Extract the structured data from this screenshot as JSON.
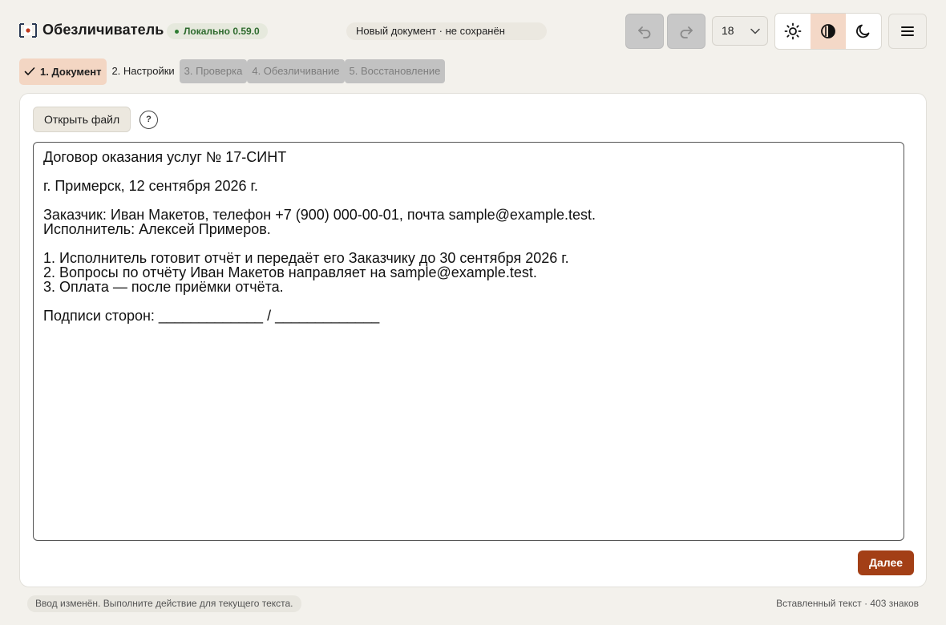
{
  "header": {
    "app_title": "Обезличиватель",
    "version_badge": "Локально 0.59.0",
    "doc_status": "Новый документ · не сохранён",
    "font_size_value": "18",
    "accent_color": "#a33f16",
    "icons": {
      "undo": "undo-icon",
      "redo": "redo-icon",
      "light_theme": "sun-icon",
      "contrast_theme": "contrast-icon",
      "dark_theme": "moon-icon",
      "menu": "hamburger-menu-icon"
    },
    "active_theme": "contrast"
  },
  "steps": [
    {
      "label": "1. Документ",
      "state": "active"
    },
    {
      "label": "2. Настройки",
      "state": "available"
    },
    {
      "label": "3. Проверка",
      "state": "disabled"
    },
    {
      "label": "4. Обезличивание",
      "state": "disabled"
    },
    {
      "label": "5. Восстановление",
      "state": "disabled"
    }
  ],
  "panel": {
    "open_file_label": "Открыть файл",
    "help_label": "?",
    "document_text": "Договор оказания услуг № 17-СИНТ\n\nг. Примерск, 12 сентября 2026 г.\n\nЗаказчик: Иван Макетов, телефон +7 (900) 000-00-01, почта sample@example.test.\nИсполнитель: Алексей Примеров.\n\n1. Исполнитель готовит отчёт и передаёт его Заказчику до 30 сентября 2026 г.\n2. Вопросы по отчёту Иван Макетов направляет на sample@example.test.\n3. Оплата — после приёмки отчёта.\n\nПодписи сторон: _____________ / _____________",
    "next_label": "Далее"
  },
  "status": {
    "left": "Ввод изменён. Выполните действие для текущего текста.",
    "right": "Вставленный текст · 403 знаков"
  }
}
